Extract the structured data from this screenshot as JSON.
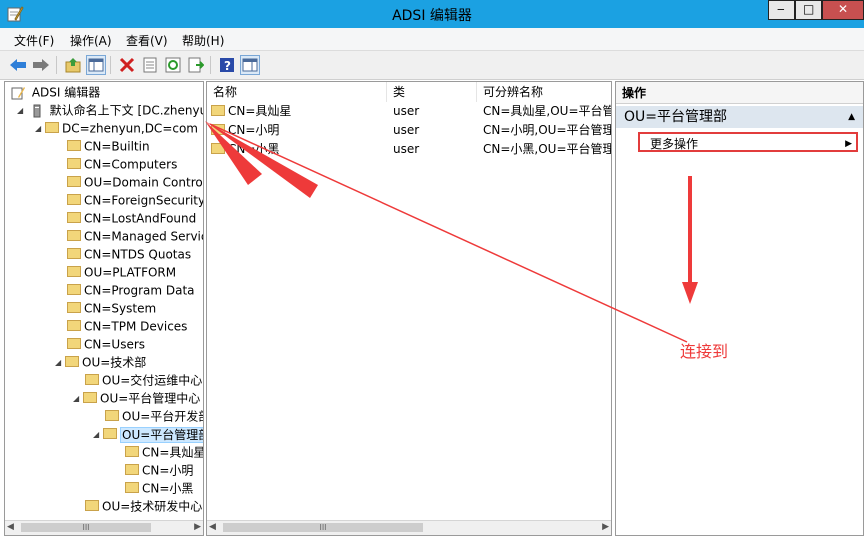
{
  "window": {
    "title": "ADSI 编辑器",
    "min_glyph": "‒",
    "max_glyph": "□",
    "close_glyph": "✕"
  },
  "menu": [
    "文件(F)",
    "操作(A)",
    "查看(V)",
    "帮助(H)"
  ],
  "tree": {
    "root": "ADSI 编辑器",
    "context": "默认命名上下文 [DC.zhenyun",
    "domain": "DC=zhenyun,DC=com",
    "items": [
      {
        "label": "CN=Builtin"
      },
      {
        "label": "CN=Computers"
      },
      {
        "label": "OU=Domain Controllers"
      },
      {
        "label": "CN=ForeignSecurityPrincipals"
      },
      {
        "label": "CN=LostAndFound"
      },
      {
        "label": "CN=Managed Service Accounts"
      },
      {
        "label": "CN=NTDS Quotas"
      },
      {
        "label": "OU=PLATFORM"
      },
      {
        "label": "CN=Program Data"
      },
      {
        "label": "CN=System"
      },
      {
        "label": "CN=TPM Devices"
      },
      {
        "label": "CN=Users"
      },
      {
        "label": "OU=技术部"
      },
      {
        "label": "OU=交付运维中心"
      },
      {
        "label": "OU=平台管理中心"
      },
      {
        "label": "OU=平台开发部"
      },
      {
        "label": "OU=平台管理部"
      },
      {
        "label": "CN=具灿星"
      },
      {
        "label": "CN=小明"
      },
      {
        "label": "CN=小黑"
      },
      {
        "label": "OU=技术研发中心"
      }
    ]
  },
  "list": {
    "columns": [
      "名称",
      "类",
      "可分辨名称"
    ],
    "rows": [
      {
        "name": "CN=具灿星",
        "class": "user",
        "dn": "CN=具灿星,OU=平台管理部"
      },
      {
        "name": "CN=小明",
        "class": "user",
        "dn": "CN=小明,OU=平台管理部"
      },
      {
        "name": "CN=小黑",
        "class": "user",
        "dn": "CN=小黑,OU=平台管理部"
      }
    ]
  },
  "actions": {
    "header": "操作",
    "section": "OU=平台管理部",
    "more": "更多操作"
  },
  "annotation": {
    "text": "连接到",
    "color": "#ee3a3a"
  },
  "scroll": {
    "left": "◀",
    "right": "▶",
    "grip": "III"
  }
}
